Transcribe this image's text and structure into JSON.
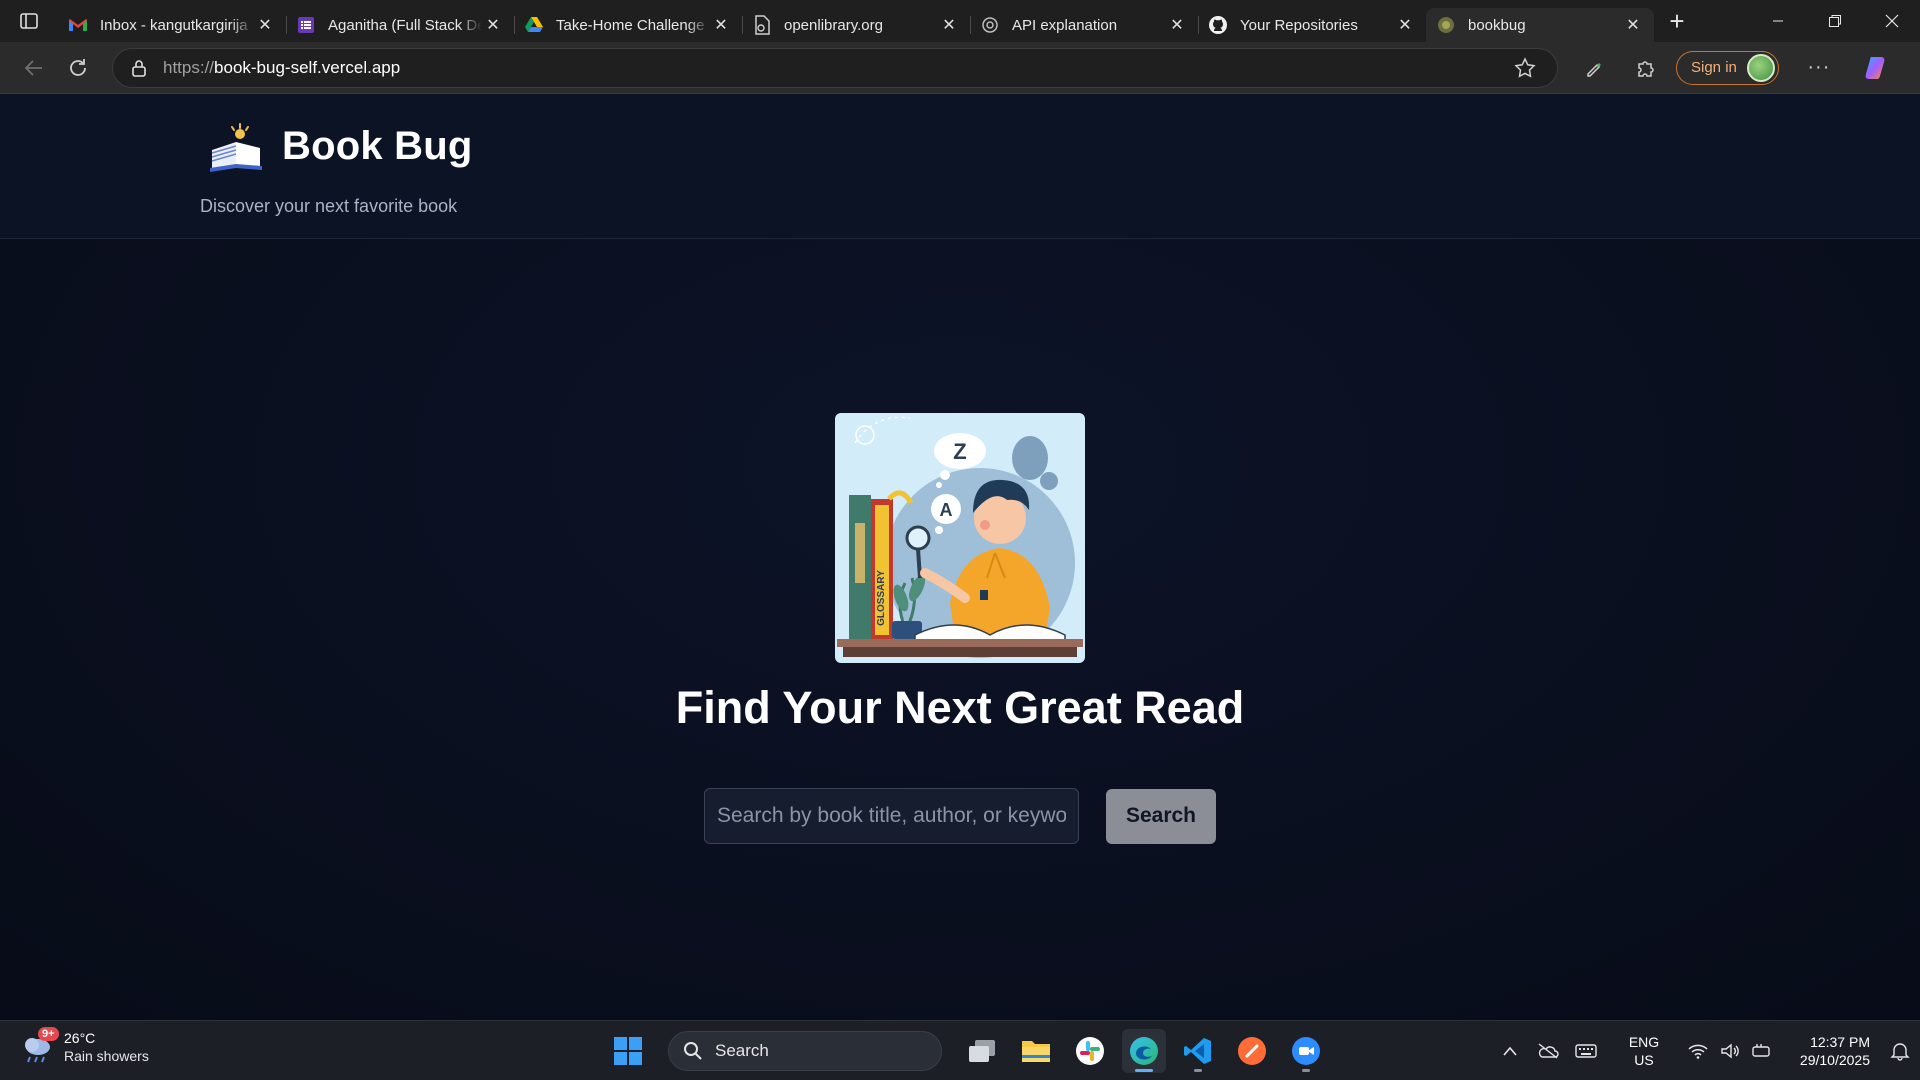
{
  "browser": {
    "tabs": [
      {
        "title": "Inbox - kangutkargirija",
        "icon": "gmail-icon"
      },
      {
        "title": "Aganitha (Full Stack De",
        "icon": "form-icon"
      },
      {
        "title": "Take-Home Challenge",
        "icon": "google-drive-icon"
      },
      {
        "title": "openlibrary.org",
        "icon": "page-icon"
      },
      {
        "title": "API explanation",
        "icon": "chatgpt-icon"
      },
      {
        "title": "Your Repositories",
        "icon": "github-icon"
      },
      {
        "title": "bookbug",
        "icon": "site-icon",
        "active": true
      }
    ],
    "address": {
      "scheme": "https://",
      "host": "book-bug-self.vercel.app"
    },
    "sign_in_label": "Sign in"
  },
  "site": {
    "brand_name": "Book Bug",
    "tagline": "Discover your next favorite book",
    "hero_title": "Find Your Next Great Read",
    "search": {
      "placeholder": "Search by book title, author, or keyword",
      "value": "",
      "button_label": "Search"
    },
    "illustration": {
      "bubble_letter_1": "Z",
      "bubble_letter_2": "A",
      "book_spine": "GLOSSARY"
    }
  },
  "taskbar": {
    "weather": {
      "badge": "9+",
      "temp": "26°C",
      "condition": "Rain showers"
    },
    "search_label": "Search",
    "language": {
      "line1": "ENG",
      "line2": "US"
    },
    "clock": {
      "time": "12:37 PM",
      "date": "29/10/2025"
    }
  }
}
